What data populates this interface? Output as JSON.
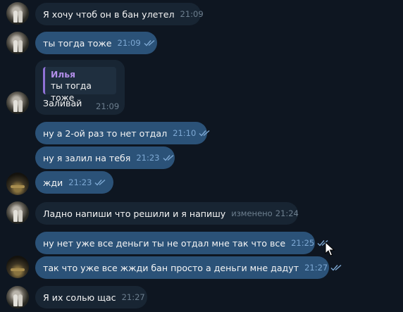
{
  "chat": {
    "messages": [
      {
        "kind": "in",
        "text": "Я хочу чтоб он в бан улетел",
        "time": "21:09"
      },
      {
        "kind": "out",
        "text": "ты тогда тоже",
        "time": "21:09",
        "read": true
      },
      {
        "kind": "in",
        "reply_to": {
          "author": "Илья",
          "text": "ты тогда тоже"
        },
        "text": "Заливай",
        "time": "21:09"
      },
      {
        "kind": "out",
        "text": "ну а 2-ой раз то нет отдал",
        "time": "21:10",
        "read": true
      },
      {
        "kind": "out",
        "text": "ну я залил на тебя",
        "time": "21:23",
        "read": true
      },
      {
        "kind": "out",
        "text": "жди",
        "time": "21:23",
        "read": true
      },
      {
        "kind": "in",
        "text": "Ладно напиши что решили и я напишу",
        "edited_label": "изменено",
        "time": "21:24"
      },
      {
        "kind": "out",
        "text": "ну нет уже все деньги ты не отдал мне так что все",
        "time": "21:25",
        "read": true
      },
      {
        "kind": "out",
        "text": "так что уже все  жжди бан просто а деньги мне дадут",
        "time": "21:27",
        "read": true
      },
      {
        "kind": "in",
        "text": "Я их солью щас",
        "time": "21:27"
      }
    ]
  },
  "icons": {
    "avatar": "user-avatar",
    "read_status": "double-check-icon",
    "cursor": "mouse-pointer-icon"
  },
  "colors": {
    "background": "#0e1621",
    "incoming_bubble": "#182533",
    "outgoing_bubble": "#2b5278",
    "quote_author": "#b28ee8",
    "quote_bar": "#8f71d6",
    "read_checks": "#7da8d3"
  }
}
